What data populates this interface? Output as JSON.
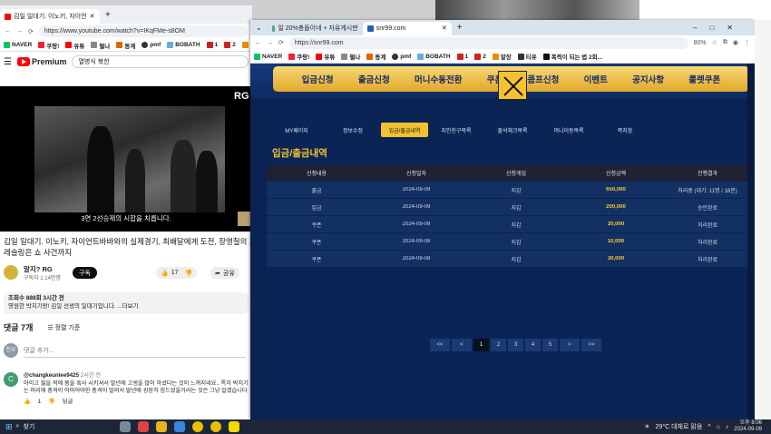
{
  "left_window": {
    "tab_title": "김일 일대기. 이노키, 자이언",
    "address": "https://www.youtube.com/watch?v=IKqFMe-s8OM",
    "bookmarks": [
      "NAVER",
      "쿠팡!",
      "유튜",
      "펄나",
      "동계",
      "pmf",
      "BOBATH",
      "1",
      "2",
      "말장"
    ],
    "youtube": {
      "logo": "Premium",
      "search_value": "열병식 북한",
      "video_subtitle": "3연 2선승제의 시합을 치릅니다.",
      "video_logo": "RG",
      "title": "김일 일대기. 이노키, 자이언트바바와의 실제경기, 최배달에게 도전, 장영철의 프로레슬링은 쇼 사건까지",
      "channel_name": "알지? RG",
      "subscribers": "구독자 1.14만명",
      "subscribe_label": "구독",
      "likes": "17",
      "share_label": "공유",
      "description_line1": "조회수 888회  3시간 전",
      "description_line2": "영원한 박치기왕! 김일  선생의 일대기입니다. ...더보기",
      "comments_count": "댓글 7개",
      "sort_label": "정렬 기준",
      "my_avatar": "진우",
      "comment_placeholder": "댓글 추가...",
      "comment_avatar": "C",
      "comment_author": "@changkeunlee9425",
      "comment_time": "2시간 전",
      "comment_text": "아이고 젊을 적에 몸을 혹사 시키셔서 말년에 고생을 많이 하셨다는 것이 느껴지네요.. 특히 박치기는 머리에 충격이 어마어마한 충격이 말려서 말년에 굉장히 힘드셨을거라는 것은 그냥 알겠습니다",
      "comment_likes": "1",
      "reply_label": "답글"
    }
  },
  "right_window": {
    "tab1": "일 20%충돌이네 + 자유게시판",
    "tab2": "snr99.com",
    "address": "https://snr99.com",
    "zoom": "80%",
    "bookmarks": [
      "NAVER",
      "쿠팡!",
      "유튜",
      "펄나",
      "동계",
      "pmf",
      "BOBATH",
      "1",
      "2",
      "말장",
      "티유",
      "폭력이 되는 법 2회..."
    ],
    "nav": [
      "입금신청",
      "출금신청",
      "머니수동전환",
      "쿠폰",
      "콤프신청",
      "이벤트",
      "공지사항",
      "룰렛쿠폰"
    ],
    "subtabs": [
      "MY페이지",
      "정보수정",
      "입금/출금내역",
      "지인친구목록",
      "출석체크목록",
      "머니이동목록",
      "쪽지함"
    ],
    "active_subtab": 2,
    "section_title": "입금/출금내역",
    "columns": [
      "신청내용",
      "신청일자",
      "신청게임",
      "신청금액",
      "진행결과"
    ],
    "rows": [
      [
        "출금",
        "2024-09-09",
        "지갑",
        "650,000",
        "처리중 (대기: 11명 / 16분)"
      ],
      [
        "입금",
        "2024-09-09",
        "지갑",
        "200,000",
        "승인완료"
      ],
      [
        "쿠폰",
        "2024-09-09",
        "지갑",
        "20,000",
        "처리완료"
      ],
      [
        "쿠폰",
        "2024-09-08",
        "지갑",
        "10,000",
        "처리완료"
      ],
      [
        "쿠폰",
        "2024-09-08",
        "지갑",
        "30,000",
        "처리완료"
      ]
    ],
    "pager": [
      "<<",
      "<",
      "1",
      "2",
      "3",
      "4",
      "5",
      ">",
      ">>"
    ],
    "active_page": "1"
  },
  "taskbar": {
    "search": "찾기",
    "weather": "29°C  대체로 맑음",
    "time": "오후 8:06",
    "date": "2024-09-09"
  }
}
